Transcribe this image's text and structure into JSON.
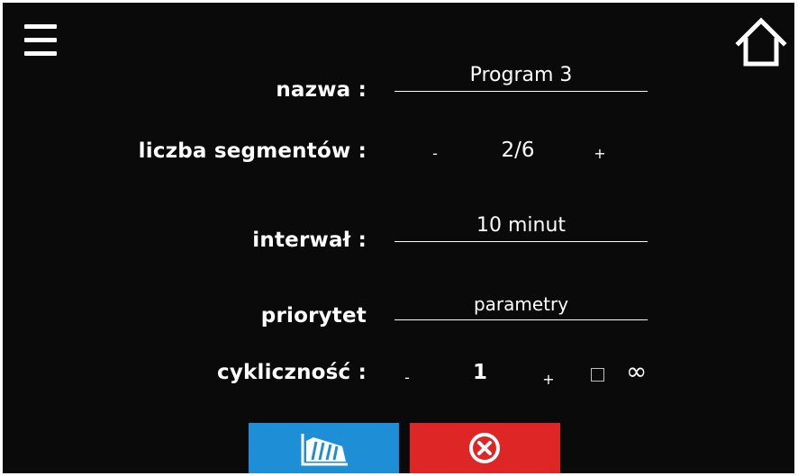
{
  "colors": {
    "background": "#0a0a0a",
    "text": "#ffffff",
    "chart_button": "#1e8fd6",
    "cancel_button": "#df2626"
  },
  "header": {
    "menu_icon": "hamburger-menu-icon",
    "home_icon": "home-icon"
  },
  "form": {
    "name": {
      "label": "nazwa :",
      "value": "Program 3"
    },
    "segments": {
      "label": "liczba segmentów :",
      "minus": "-",
      "value": "2/6",
      "plus": "+"
    },
    "interval": {
      "label": "interwał :",
      "value": "10 minut"
    },
    "priority": {
      "label": "priorytet",
      "value": "parametry"
    },
    "cyclicity": {
      "label": "cykliczność :",
      "minus": "-",
      "value": "1",
      "plus": "+",
      "infinite_checked": false,
      "infinity_symbol": "∞"
    }
  },
  "footer": {
    "chart_button_icon": "profile-chart-icon",
    "cancel_button_icon": "cancel-circle-x-icon"
  }
}
